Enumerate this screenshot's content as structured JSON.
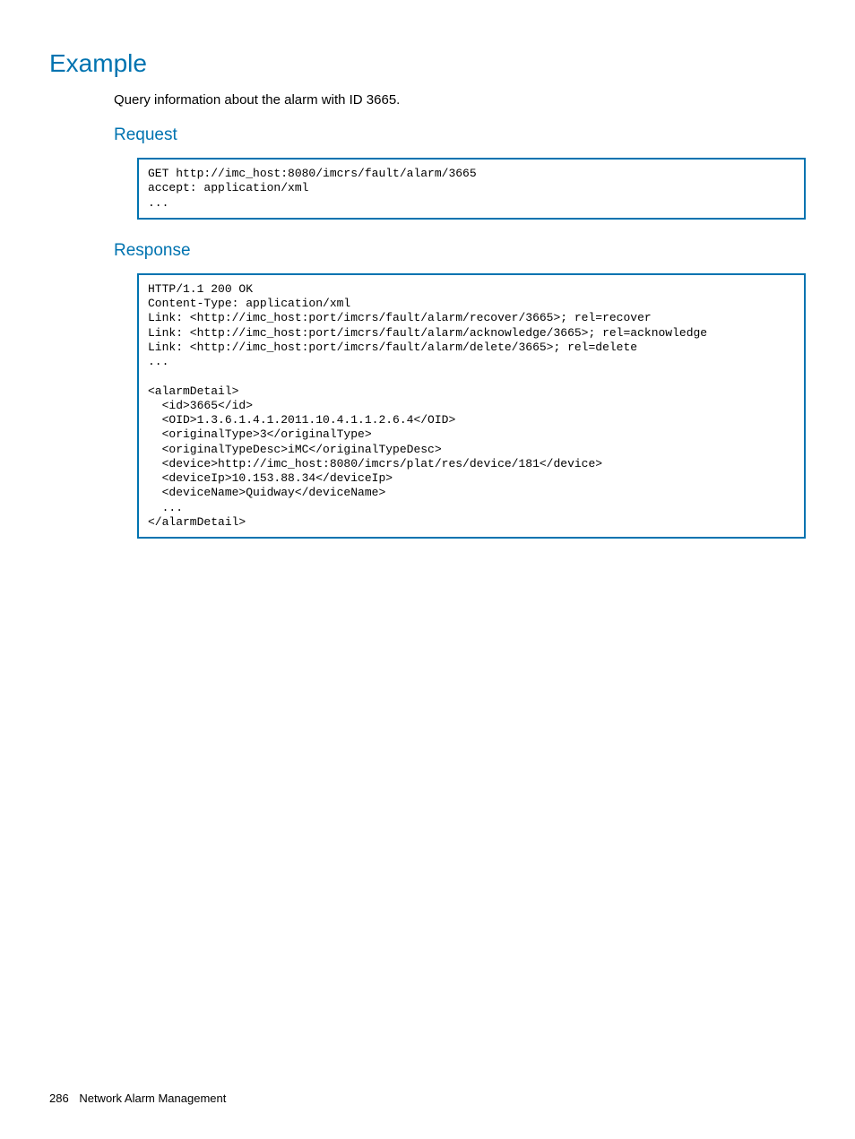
{
  "headings": {
    "example": "Example",
    "request": "Request",
    "response": "Response"
  },
  "description": "Query information about the alarm with ID 3665.",
  "code": {
    "request": "GET http://imc_host:8080/imcrs/fault/alarm/3665\naccept: application/xml\n...",
    "response": "HTTP/1.1 200 OK\nContent-Type: application/xml\nLink: <http://imc_host:port/imcrs/fault/alarm/recover/3665>; rel=recover\nLink: <http://imc_host:port/imcrs/fault/alarm/acknowledge/3665>; rel=acknowledge\nLink: <http://imc_host:port/imcrs/fault/alarm/delete/3665>; rel=delete\n...\n\n<alarmDetail>\n  <id>3665</id>\n  <OID>1.3.6.1.4.1.2011.10.4.1.1.2.6.4</OID>\n  <originalType>3</originalType>\n  <originalTypeDesc>iMC</originalTypeDesc>\n  <device>http://imc_host:8080/imcrs/plat/res/device/181</device>\n  <deviceIp>10.153.88.34</deviceIp>\n  <deviceName>Quidway</deviceName>\n  ...\n</alarmDetail>"
  },
  "footer": {
    "pageNumber": "286",
    "section": "Network Alarm Management"
  }
}
